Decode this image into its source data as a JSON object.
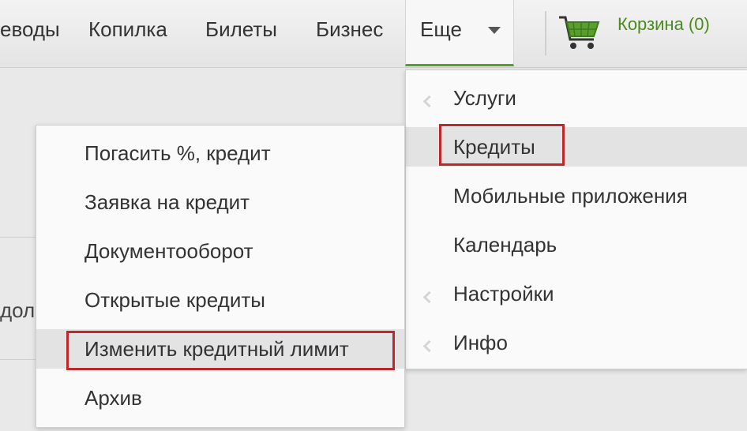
{
  "nav": {
    "items": [
      "еводы",
      "Копилка",
      "Билеты",
      "Бизнес"
    ],
    "more_label": "Еще",
    "cart_label": "Корзина (0)"
  },
  "menu_more": {
    "items": [
      {
        "label": "Услуги",
        "has_submenu": true
      },
      {
        "label": "Кредиты",
        "has_submenu": false,
        "active": true,
        "highlighted": true
      },
      {
        "label": "Мобильные приложения",
        "has_submenu": false
      },
      {
        "label": "Календарь",
        "has_submenu": false
      },
      {
        "label": "Настройки",
        "has_submenu": true
      },
      {
        "label": "Инфо",
        "has_submenu": true
      }
    ]
  },
  "menu_credits": {
    "items": [
      {
        "label": "Погасить %, кредит"
      },
      {
        "label": "Заявка на кредит"
      },
      {
        "label": "Документооборот"
      },
      {
        "label": "Открытые кредиты"
      },
      {
        "label": "Изменить кредитный лимит",
        "active": true,
        "highlighted": true
      },
      {
        "label": "Архив"
      }
    ]
  },
  "background": {
    "partial_text": "дол"
  },
  "colors": {
    "accent_green": "#5a9e2e",
    "highlight_red": "#c0272d"
  }
}
